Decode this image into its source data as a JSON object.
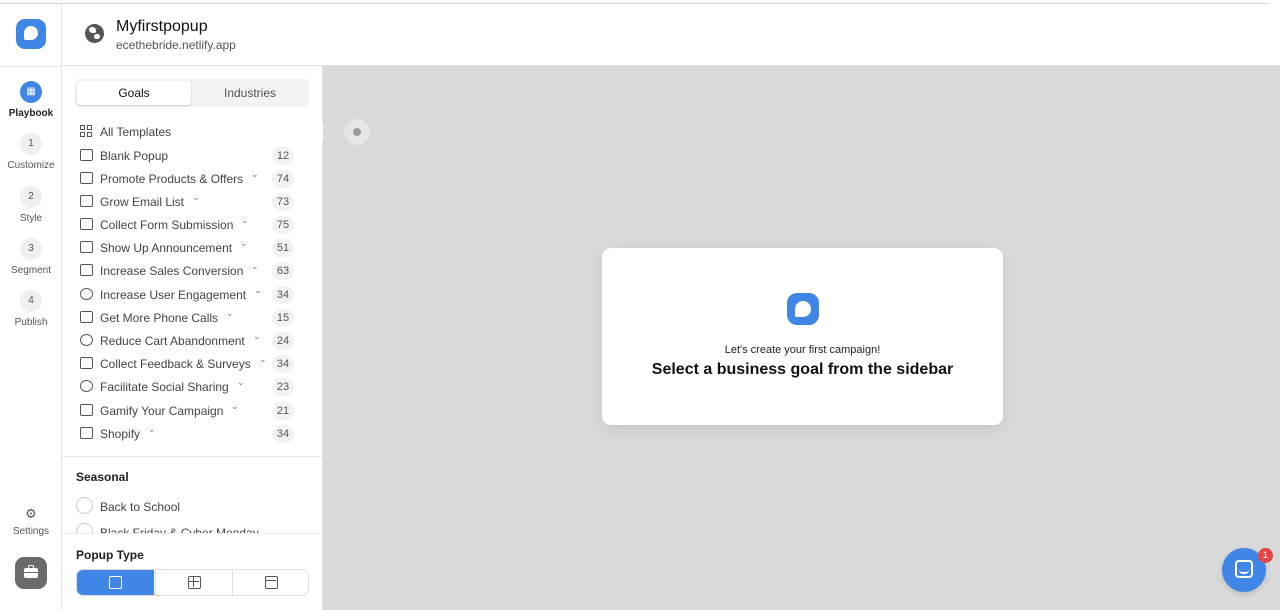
{
  "app": {
    "brand_color": "#3f86e6"
  },
  "rail": {
    "steps": [
      {
        "number": "",
        "label": "Playbook",
        "active": true
      },
      {
        "number": "1",
        "label": "Customize"
      },
      {
        "number": "2",
        "label": "Style"
      },
      {
        "number": "3",
        "label": "Segment"
      },
      {
        "number": "4",
        "label": "Publish"
      }
    ],
    "settings_label": "Settings"
  },
  "header": {
    "site_name": "Myfirstpopup",
    "site_url": "ecethebride.netlify.app"
  },
  "sidebar": {
    "tabs": [
      "Goals",
      "Industries"
    ],
    "goals": [
      {
        "label": "All Templates",
        "count": "",
        "chevron": false,
        "icon": "grid-icon"
      },
      {
        "label": "Blank Popup",
        "count": "12",
        "chevron": false,
        "icon": "blank-popup-icon"
      },
      {
        "label": "Promote Products & Offers",
        "count": "74",
        "chevron": true,
        "icon": "megaphone-icon"
      },
      {
        "label": "Grow Email List",
        "count": "73",
        "chevron": true,
        "icon": "mail-icon"
      },
      {
        "label": "Collect Form Submission",
        "count": "75",
        "chevron": true,
        "icon": "form-icon"
      },
      {
        "label": "Show Up Announcement",
        "count": "51",
        "chevron": true,
        "icon": "bell-icon"
      },
      {
        "label": "Increase Sales Conversion",
        "count": "63",
        "chevron": true,
        "icon": "chart-icon"
      },
      {
        "label": "Increase User Engagement",
        "count": "34",
        "chevron": true,
        "icon": "users-icon"
      },
      {
        "label": "Get More Phone Calls",
        "count": "15",
        "chevron": true,
        "icon": "headphones-icon"
      },
      {
        "label": "Reduce Cart Abandonment",
        "count": "24",
        "chevron": true,
        "icon": "sad-face-icon"
      },
      {
        "label": "Collect Feedback & Surveys",
        "count": "34",
        "chevron": true,
        "icon": "checklist-icon"
      },
      {
        "label": "Facilitate Social Sharing",
        "count": "23",
        "chevron": true,
        "icon": "heart-icon"
      },
      {
        "label": "Gamify Your Campaign",
        "count": "21",
        "chevron": true,
        "icon": "gamepad-icon"
      },
      {
        "label": "Shopify",
        "count": "34",
        "chevron": true,
        "icon": "shopify-bag-icon"
      }
    ],
    "seasonal_title": "Seasonal",
    "seasonal_items": [
      "Back to School",
      "Black Friday & Cyber Monday"
    ],
    "popup_type_title": "Popup Type"
  },
  "canvas": {
    "subtitle": "Let's create your first campaign!",
    "title": "Select a business goal from the sidebar"
  },
  "chat": {
    "badge_count": "1"
  }
}
